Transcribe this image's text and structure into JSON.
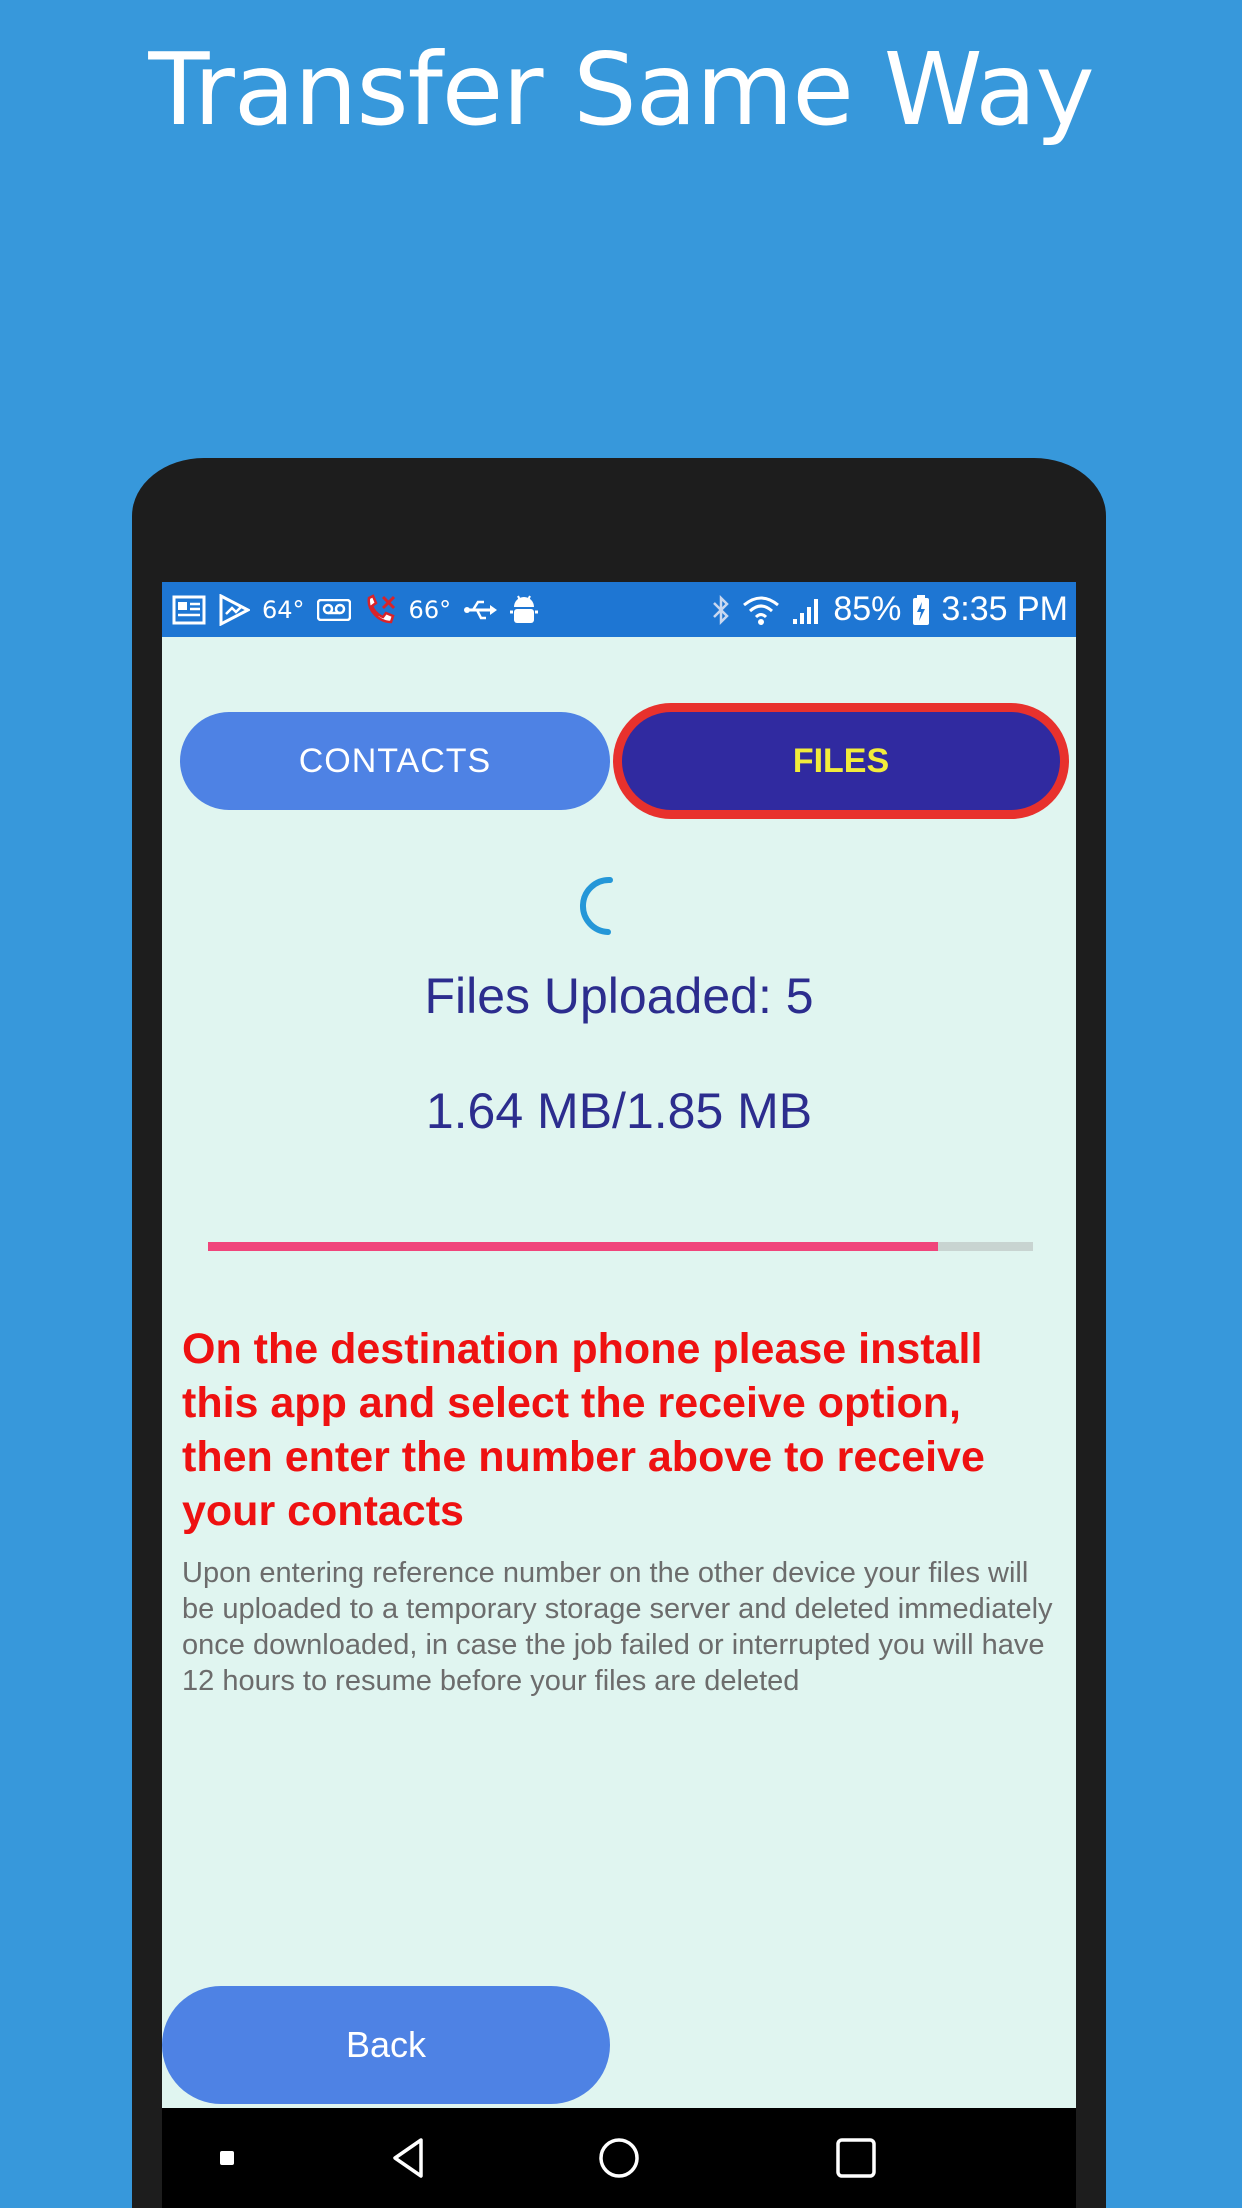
{
  "promo": {
    "title": "Transfer Same Way"
  },
  "status_bar": {
    "temp1": "64°",
    "temp2": "66°",
    "battery": "85%",
    "time": "3:35 PM",
    "icons_left": [
      "news-icon",
      "play-store-icon",
      "voicemail-icon",
      "missed-call-icon",
      "usb-icon",
      "android-debug-icon"
    ],
    "icons_right": [
      "bluetooth-icon",
      "wifi-icon",
      "signal-icon",
      "battery-icon"
    ]
  },
  "tabs": {
    "contacts_label": "CONTACTS",
    "files_label": "FILES",
    "selected": "FILES"
  },
  "transfer": {
    "files_uploaded": "Files Uploaded: 5",
    "size_progress": "1.64 MB/1.85 MB",
    "progress_fraction": 0.885
  },
  "instructions": {
    "warning": "On the destination phone please install this app and select the receive option, then enter the number above to receive your contacts",
    "info": "Upon entering reference number on the other device your files will be uploaded to a temporary storage server and deleted immediately once downloaded, in case the job failed or interrupted you will have 12 hours to resume before your files are deleted"
  },
  "actions": {
    "back_label": "Back"
  },
  "nav_bar": {
    "icons": [
      "recent-dot-icon",
      "back-icon",
      "home-icon",
      "overview-icon"
    ]
  },
  "colors": {
    "background": "#3798db",
    "screen": "#e0f5f0",
    "status_bar": "#1e76d3",
    "button_blue": "#4e82e4",
    "tab_selected": "#302aa0",
    "tab_selected_text": "#f2ec3b",
    "highlight_outline": "#e8312d",
    "progress_fill": "#f0457b",
    "warning_text": "#ee1111",
    "heading_text": "#2c2d8e"
  }
}
